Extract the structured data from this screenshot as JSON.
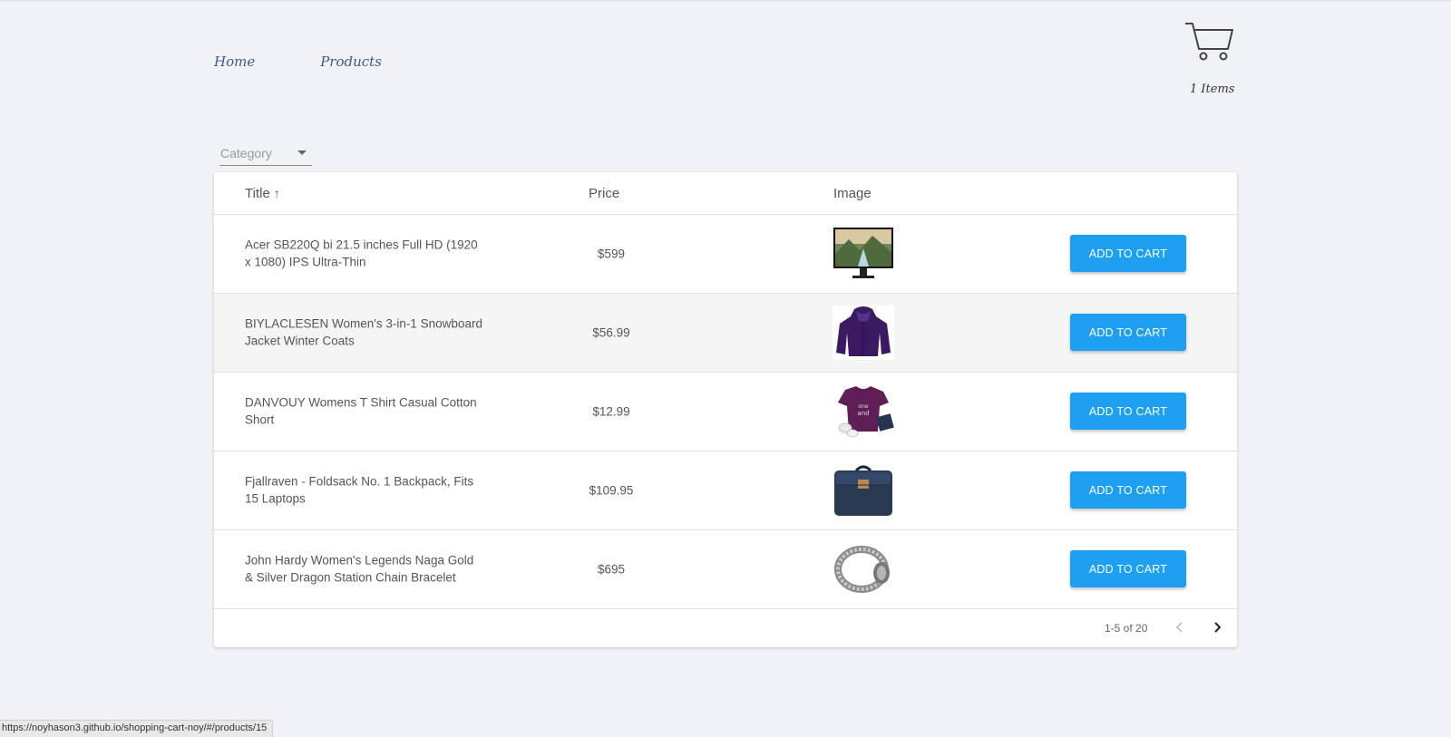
{
  "nav": {
    "home": "Home",
    "products": "Products"
  },
  "cart": {
    "count_label": "1 Items"
  },
  "filter": {
    "category_label": "Category"
  },
  "table": {
    "headers": {
      "title": "Title",
      "price": "Price",
      "image": "Image"
    },
    "sort_indicator": "↑",
    "rows": [
      {
        "title": "Acer SB220Q bi 21.5 inches Full HD (1920 x 1080) IPS Ultra-Thin",
        "price": "$599",
        "image": "monitor",
        "button": "ADD TO CART"
      },
      {
        "title": "BIYLACLESEN Women's 3-in-1 Snowboard Jacket Winter Coats",
        "price": "$56.99",
        "image": "purple-jacket",
        "button": "ADD TO CART"
      },
      {
        "title": "DANVOUY Womens T Shirt Casual Cotton Short",
        "price": "$12.99",
        "image": "purple-tshirt",
        "button": "ADD TO CART"
      },
      {
        "title": "Fjallraven - Foldsack No. 1 Backpack, Fits 15 Laptops",
        "price": "$109.95",
        "image": "navy-backpack",
        "button": "ADD TO CART"
      },
      {
        "title": "John Hardy Women's Legends Naga Gold & Silver Dragon Station Chain Bracelet",
        "price": "$695",
        "image": "silver-bracelet",
        "button": "ADD TO CART"
      }
    ]
  },
  "pagination": {
    "range": "1-5 of 20"
  },
  "status_bar": {
    "url": "https://noyhason3.github.io/shopping-cart-noy/#/products/15"
  },
  "colors": {
    "background": "#f0f2f6",
    "nav_link": "#3f5a86",
    "button": "#1e9ff2",
    "alt_row": "#f5f5f5"
  }
}
